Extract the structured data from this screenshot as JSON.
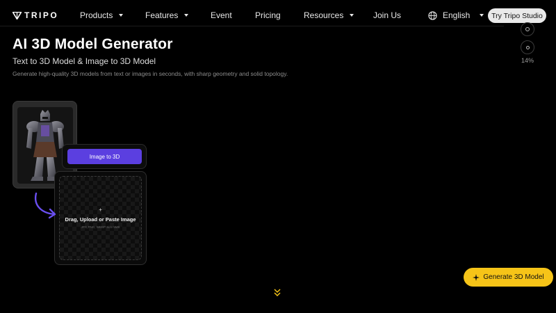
{
  "nav": {
    "logo": "TRIPO",
    "items": [
      {
        "label": "Products",
        "has_caret": true
      },
      {
        "label": "Features",
        "has_caret": true
      },
      {
        "label": "Event",
        "has_caret": false
      },
      {
        "label": "Pricing",
        "has_caret": false
      },
      {
        "label": "Resources",
        "has_caret": true
      },
      {
        "label": "Join Us",
        "has_caret": false
      }
    ],
    "language": "English",
    "try_button": "Try Tripo Studio"
  },
  "side_rail": {
    "progress": "14%"
  },
  "hero": {
    "title": "AI 3D Model Generator",
    "subtitle": "Text to 3D Model & Image to 3D Model",
    "description": "Generate high-quality 3D models from text or images in seconds, with sharp geometry and solid topology."
  },
  "demo": {
    "mode_button": "Image to 3D",
    "upload_plus": "+",
    "upload_label": "Drag, Upload or Paste Image",
    "upload_hint": "JPG,PNG, WEBP Size 5MB"
  },
  "cta": {
    "generate_button": "Generate 3D Model"
  },
  "colors": {
    "accent_purple": "#5b3fe0",
    "cta_yellow": "#f6c418",
    "background": "#000000"
  }
}
